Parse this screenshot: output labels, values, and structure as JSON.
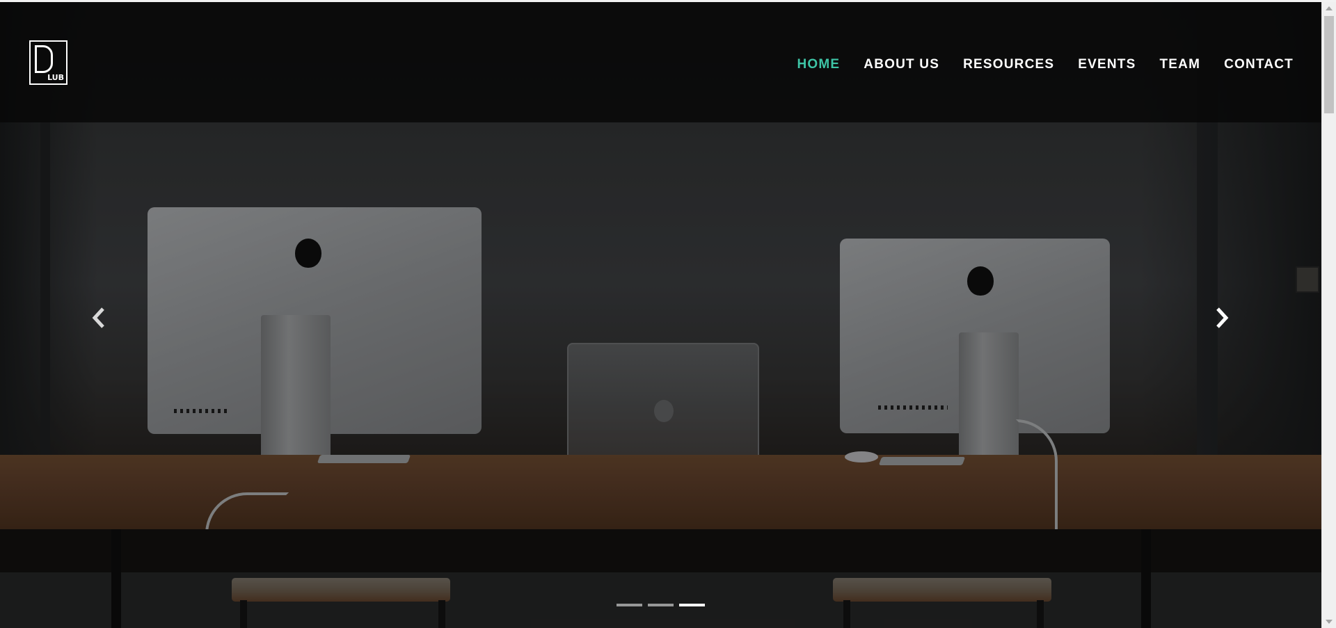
{
  "header": {
    "logo_text": "LUB",
    "nav": [
      {
        "label": "HOME",
        "active": true
      },
      {
        "label": "ABOUT US",
        "active": false
      },
      {
        "label": "RESOURCES",
        "active": false
      },
      {
        "label": "EVENTS",
        "active": false
      },
      {
        "label": "TEAM",
        "active": false
      },
      {
        "label": "CONTACT",
        "active": false
      }
    ]
  },
  "carousel": {
    "slide_count": 3,
    "active_slide": 3,
    "prev_icon": "chevron-left-icon",
    "next_icon": "chevron-right-icon",
    "image": "photo-desk-with-two-imacs-and-laptop"
  },
  "colors": {
    "accent": "#3ec4a6",
    "nav_text": "#ffffff",
    "header_bg": "#080808"
  }
}
